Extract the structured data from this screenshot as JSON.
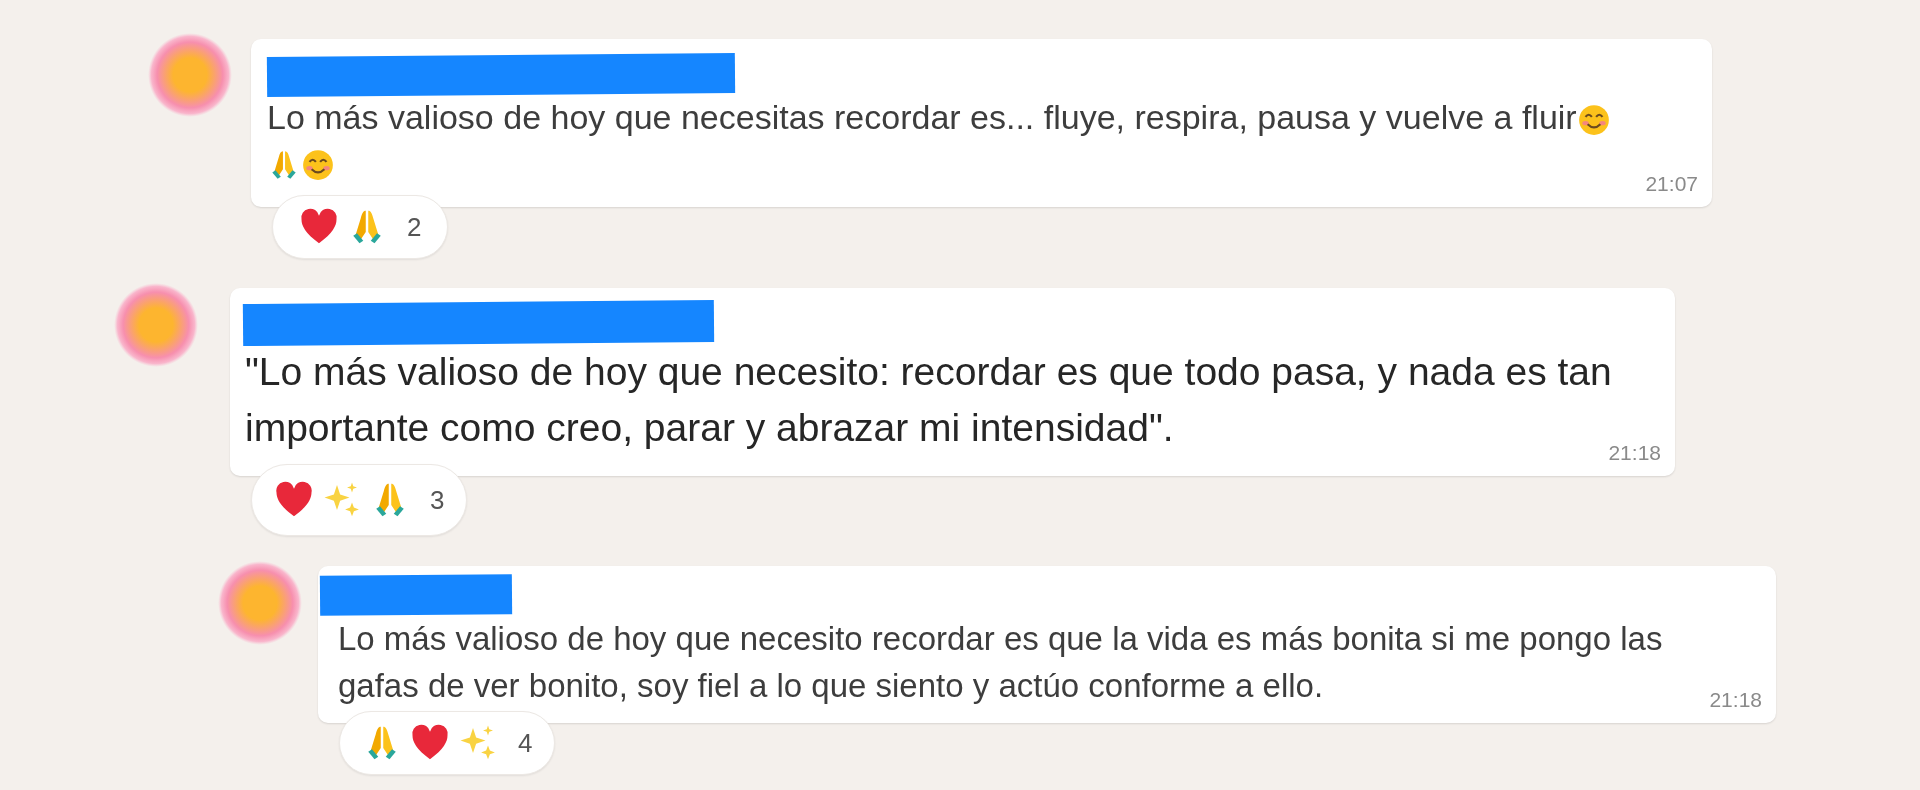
{
  "messages": [
    {
      "lines": [
        "Lo más valioso de hoy que necesitas recordar es... fluye, respira, pausa y vuelve a fluir"
      ],
      "emoji_rows": [
        [
          {
            "kind": "smiling-face"
          }
        ],
        [
          {
            "kind": "praying-hands"
          },
          {
            "kind": "smiling-face"
          }
        ]
      ],
      "time": "21:07",
      "reactions": {
        "emojis": [
          {
            "kind": "heart"
          },
          {
            "kind": "praying-hands"
          }
        ],
        "count": "2"
      }
    },
    {
      "lines": [
        "\"Lo más valioso de hoy que necesito: recordar es que todo pasa, y nada es tan",
        "importante como creo, parar y abrazar mi intensidad\"."
      ],
      "time": "21:18",
      "reactions": {
        "emojis": [
          {
            "kind": "heart"
          },
          {
            "kind": "sparkles"
          },
          {
            "kind": "praying-hands"
          }
        ],
        "count": "3"
      }
    },
    {
      "lines": [
        "Lo más valioso de hoy que necesito recordar es que la vida es más bonita si me pongo las",
        "gafas de ver bonito, soy fiel a lo que siento y actúo conforme a ello."
      ],
      "time": "21:18",
      "reactions": {
        "emojis": [
          {
            "kind": "praying-hands"
          },
          {
            "kind": "heart"
          },
          {
            "kind": "sparkles"
          }
        ],
        "count": "4"
      }
    }
  ]
}
